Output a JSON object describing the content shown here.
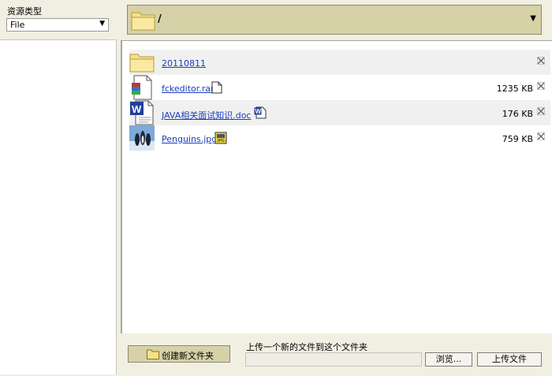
{
  "resource_type": {
    "label": "资源类型",
    "selected": "File"
  },
  "path_bar": {
    "path": "/"
  },
  "files": [
    {
      "name": "20110811",
      "kind": "folder",
      "size": "",
      "small_icon": ""
    },
    {
      "name": "fckeditor.rar",
      "kind": "rar",
      "size": "1235 KB",
      "small_icon": "blank-file-icon"
    },
    {
      "name": "JAVA相关面试知识.doc",
      "kind": "doc",
      "size": "176 KB",
      "small_icon": "word-doc-icon"
    },
    {
      "name": "Penguins.jpg",
      "kind": "jpg",
      "size": "759 KB",
      "small_icon": "jpeg-image-icon"
    }
  ],
  "bottom": {
    "new_folder_label": "创建新文件夹",
    "upload_label": "上传一个新的文件到这个文件夹",
    "browse_label": "浏览...",
    "upload_button_label": "上传文件"
  }
}
